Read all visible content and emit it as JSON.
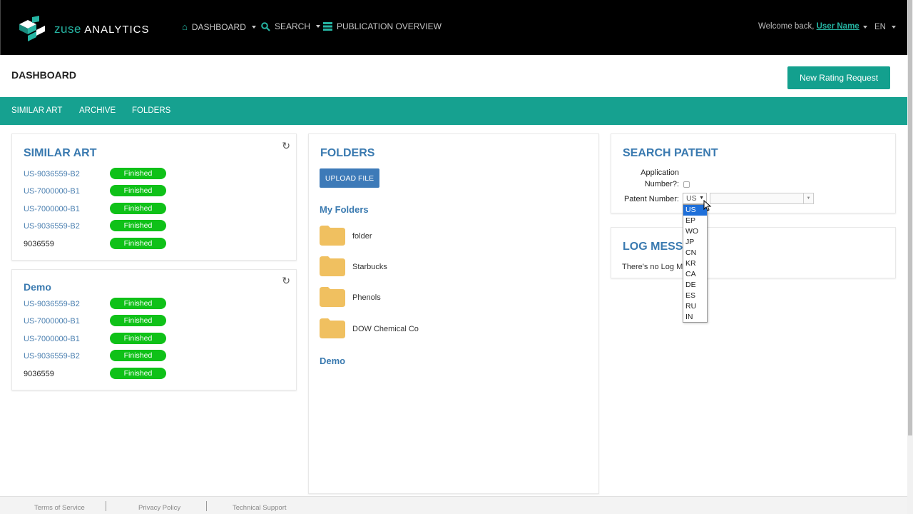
{
  "brand": {
    "name_part1": "zuse",
    "name_part2": "ANALYTICS",
    "accent": "#26b5a3"
  },
  "nav": {
    "items": [
      {
        "label": "DASHBOARD",
        "icon": "home-icon"
      },
      {
        "label": "SEARCH",
        "icon": "search-icon"
      },
      {
        "label": "PUBLICATION OVERVIEW",
        "icon": "list-icon"
      }
    ],
    "welcome_prefix": "Welcome back,",
    "user_name": "User Name",
    "language": "EN"
  },
  "header": {
    "title": "DASHBOARD",
    "rating_button": "New Rating Request"
  },
  "subnav": {
    "items": [
      "SIMILAR ART",
      "ARCHIVE",
      "FOLDERS"
    ],
    "color": "#16a190"
  },
  "similar_art": {
    "title": "SIMILAR ART",
    "rows": [
      {
        "id": "US-9036559-B2",
        "status": "Finished"
      },
      {
        "id": "US-7000000-B1",
        "status": "Finished"
      },
      {
        "id": "US-7000000-B1",
        "status": "Finished"
      },
      {
        "id": "US-9036559-B2",
        "status": "Finished"
      },
      {
        "id": "9036559",
        "status": "Finished"
      }
    ]
  },
  "demo": {
    "title": "Demo",
    "rows": [
      {
        "id": "US-9036559-B2",
        "status": "Finished"
      },
      {
        "id": "US-7000000-B1",
        "status": "Finished"
      },
      {
        "id": "US-7000000-B1",
        "status": "Finished"
      },
      {
        "id": "US-9036559-B2",
        "status": "Finished"
      },
      {
        "id": "9036559",
        "status": "Finished"
      }
    ]
  },
  "folders": {
    "title": "FOLDERS",
    "upload_button": "UPLOAD FILE",
    "my_folders_title": "My Folders",
    "items": [
      "folder",
      "Starbucks",
      "Phenols",
      "DOW Chemical Co"
    ],
    "demo_title": "Demo"
  },
  "search_patent": {
    "title": "SEARCH PATENT",
    "application_label_1": "Application",
    "application_label_2": "Number?:",
    "patent_label": "Patent Number:",
    "selected_country": "US",
    "country_options": [
      "US",
      "EP",
      "WO",
      "JP",
      "CN",
      "KR",
      "CA",
      "DE",
      "ES",
      "RU",
      "IN"
    ]
  },
  "log": {
    "title": "LOG MESSA",
    "text": "There's no Log Me"
  },
  "footer": {
    "links": [
      "Terms of Service",
      "Privacy Policy",
      "Technical Support"
    ]
  },
  "status_color": "#0fc118"
}
